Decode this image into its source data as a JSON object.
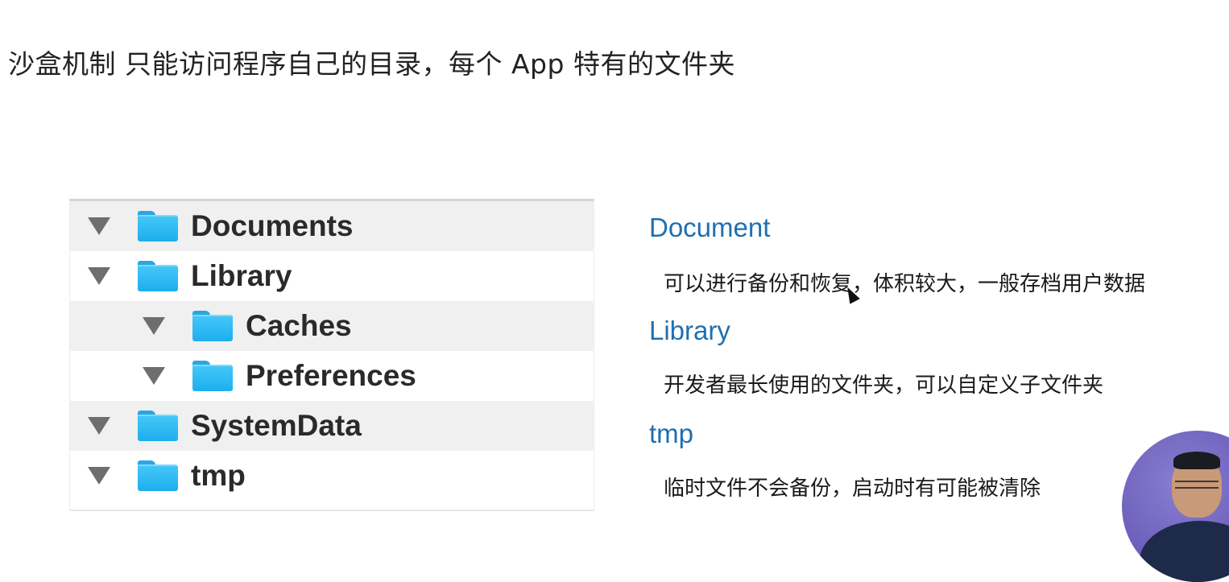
{
  "slide": {
    "title": "沙盒机制 只能访问程序自己的目录，每个 App 特有的文件夹"
  },
  "tree": {
    "rows": [
      {
        "label": "Documents",
        "indent": 0,
        "expanded": true,
        "icon": "folder-icon"
      },
      {
        "label": "Library",
        "indent": 0,
        "expanded": true,
        "icon": "folder-icon"
      },
      {
        "label": "Caches",
        "indent": 1,
        "expanded": true,
        "icon": "folder-icon"
      },
      {
        "label": "Preferences",
        "indent": 1,
        "expanded": true,
        "icon": "folder-icon"
      },
      {
        "label": "SystemData",
        "indent": 0,
        "expanded": true,
        "icon": "folder-icon"
      },
      {
        "label": "tmp",
        "indent": 0,
        "expanded": true,
        "icon": "folder-icon"
      }
    ]
  },
  "descriptions": [
    {
      "heading": "Document",
      "text": "可以进行备份和恢复，体积较大，一般存档用户数据"
    },
    {
      "heading": "Library",
      "text": "开发者最长使用的文件夹，可以自定义子文件夹"
    },
    {
      "heading": "tmp",
      "text": "临时文件不会备份，启动时有可能被清除"
    }
  ],
  "colors": {
    "heading_blue": "#1f6fb0",
    "folder_blue": "#2ab4f0",
    "row_shade": "#f0f0f0",
    "presenter_bg": "#6e61bd"
  }
}
